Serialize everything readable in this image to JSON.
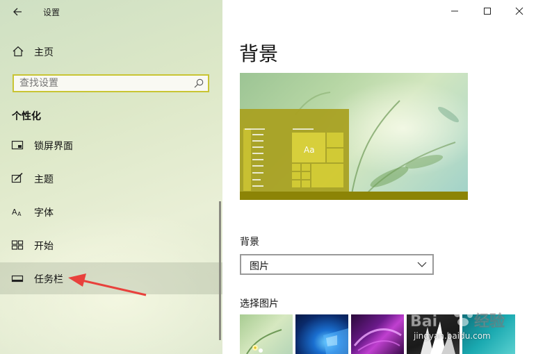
{
  "window": {
    "title": "设置",
    "back_icon": "back-arrow-icon",
    "controls": [
      "minimize-icon",
      "maximize-icon",
      "close-icon"
    ]
  },
  "sidebar": {
    "home": {
      "label": "主页",
      "icon": "home-icon"
    },
    "search": {
      "placeholder": "查找设置",
      "value": "",
      "icon": "search-icon"
    },
    "section_title": "个性化",
    "items": [
      {
        "label": "锁屏界面",
        "icon": "lockscreen-icon",
        "active": false
      },
      {
        "label": "主题",
        "icon": "theme-brush-icon",
        "active": false
      },
      {
        "label": "字体",
        "icon": "font-icon",
        "active": false
      },
      {
        "label": "开始",
        "icon": "start-tiles-icon",
        "active": false
      },
      {
        "label": "任务栏",
        "icon": "taskbar-icon",
        "active": true
      }
    ]
  },
  "main": {
    "page_title": "背景",
    "preview": {
      "tile_text": "Aa"
    },
    "background_label": "背景",
    "background_dropdown": {
      "selected": "图片"
    },
    "choose_picture_label": "选择图片",
    "thumbnails": [
      "green-meadow-flower",
      "windows-blue-light",
      "purple-swirl",
      "white-crystals",
      "teal-waves"
    ]
  },
  "watermark": {
    "text": "jingyan.baidu.com"
  },
  "colors": {
    "accent_yellow": "#c8c433",
    "tile_yellow": "#d2c92e",
    "startmenu": "#a9a223",
    "annotation_red": "#e8413c"
  }
}
